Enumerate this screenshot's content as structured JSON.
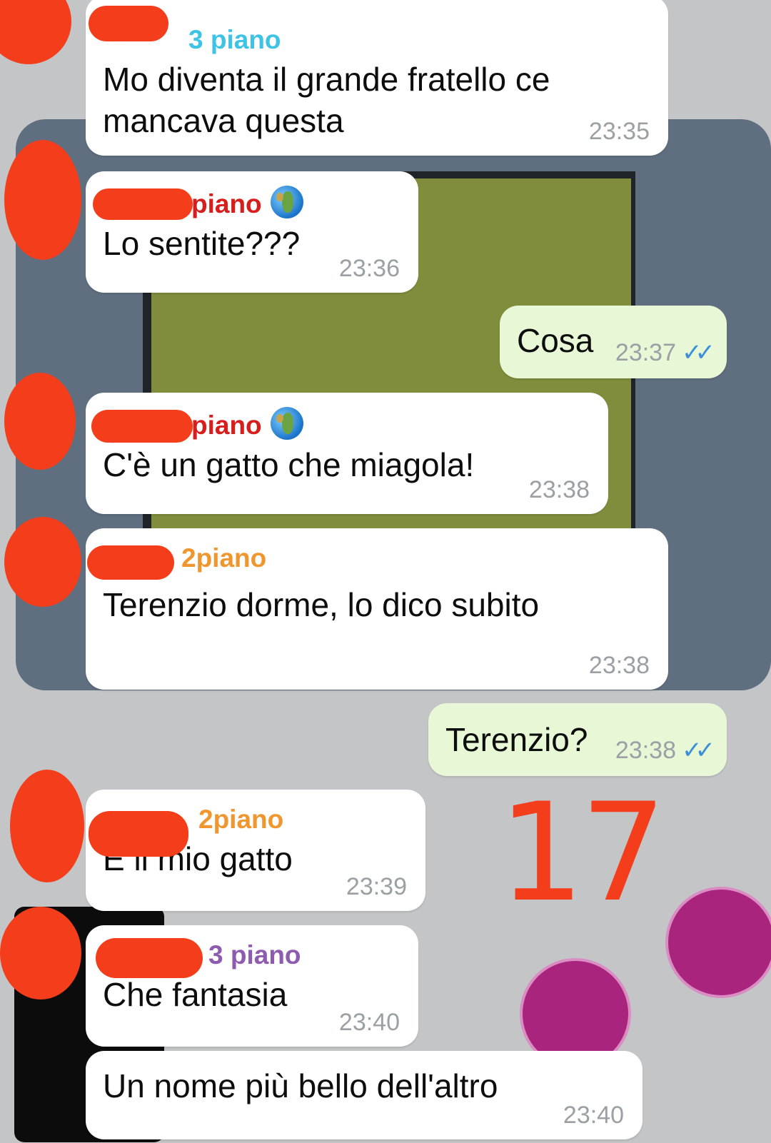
{
  "messages": [
    {
      "sender": "3 piano",
      "text": "Mo diventa il grande fratello ce mancava questa",
      "time": "23:35"
    },
    {
      "sender": "piano",
      "text": "Lo sentite???",
      "time": "23:36"
    },
    {
      "text": "Cosa",
      "time": "23:37",
      "status": "read"
    },
    {
      "sender": "piano",
      "text": "C'è un gatto che miagola!",
      "time": "23:38"
    },
    {
      "sender": "2piano",
      "text": "Terenzio dorme, lo dico subito",
      "time": "23:38"
    },
    {
      "text": "Terenzio?",
      "time": "23:38",
      "status": "read"
    },
    {
      "sender": "2piano",
      "text": "È il mio gatto",
      "time": "23:39"
    },
    {
      "sender": "3 piano",
      "text": "Che fantasia",
      "time": "23:40"
    },
    {
      "text": "Un nome più bello dell'altro",
      "time": "23:40"
    }
  ],
  "ticks": "✓✓",
  "annotation": "17",
  "colors": {
    "sender_cyan": "#3ec3e6",
    "sender_red": "#d81d1d",
    "sender_orange": "#f0962f",
    "sender_purple": "#8e5cae",
    "outgoing_bubble": "#e8f8d6",
    "read_ticks": "#3d8fd8",
    "redaction": "#f33d1b"
  },
  "icons": {
    "globe": "globe-icon",
    "read": "double-check-icon"
  }
}
